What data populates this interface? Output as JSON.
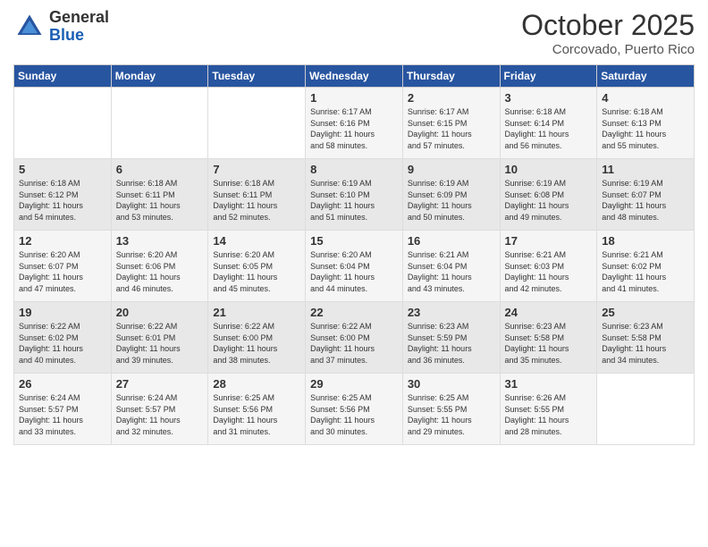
{
  "header": {
    "logo": {
      "text_general": "General",
      "text_blue": "Blue"
    },
    "title": "October 2025",
    "subtitle": "Corcovado, Puerto Rico"
  },
  "days_of_week": [
    "Sunday",
    "Monday",
    "Tuesday",
    "Wednesday",
    "Thursday",
    "Friday",
    "Saturday"
  ],
  "weeks": [
    [
      {
        "day": "",
        "info": ""
      },
      {
        "day": "",
        "info": ""
      },
      {
        "day": "",
        "info": ""
      },
      {
        "day": "1",
        "info": "Sunrise: 6:17 AM\nSunset: 6:16 PM\nDaylight: 11 hours\nand 58 minutes."
      },
      {
        "day": "2",
        "info": "Sunrise: 6:17 AM\nSunset: 6:15 PM\nDaylight: 11 hours\nand 57 minutes."
      },
      {
        "day": "3",
        "info": "Sunrise: 6:18 AM\nSunset: 6:14 PM\nDaylight: 11 hours\nand 56 minutes."
      },
      {
        "day": "4",
        "info": "Sunrise: 6:18 AM\nSunset: 6:13 PM\nDaylight: 11 hours\nand 55 minutes."
      }
    ],
    [
      {
        "day": "5",
        "info": "Sunrise: 6:18 AM\nSunset: 6:12 PM\nDaylight: 11 hours\nand 54 minutes."
      },
      {
        "day": "6",
        "info": "Sunrise: 6:18 AM\nSunset: 6:11 PM\nDaylight: 11 hours\nand 53 minutes."
      },
      {
        "day": "7",
        "info": "Sunrise: 6:18 AM\nSunset: 6:11 PM\nDaylight: 11 hours\nand 52 minutes."
      },
      {
        "day": "8",
        "info": "Sunrise: 6:19 AM\nSunset: 6:10 PM\nDaylight: 11 hours\nand 51 minutes."
      },
      {
        "day": "9",
        "info": "Sunrise: 6:19 AM\nSunset: 6:09 PM\nDaylight: 11 hours\nand 50 minutes."
      },
      {
        "day": "10",
        "info": "Sunrise: 6:19 AM\nSunset: 6:08 PM\nDaylight: 11 hours\nand 49 minutes."
      },
      {
        "day": "11",
        "info": "Sunrise: 6:19 AM\nSunset: 6:07 PM\nDaylight: 11 hours\nand 48 minutes."
      }
    ],
    [
      {
        "day": "12",
        "info": "Sunrise: 6:20 AM\nSunset: 6:07 PM\nDaylight: 11 hours\nand 47 minutes."
      },
      {
        "day": "13",
        "info": "Sunrise: 6:20 AM\nSunset: 6:06 PM\nDaylight: 11 hours\nand 46 minutes."
      },
      {
        "day": "14",
        "info": "Sunrise: 6:20 AM\nSunset: 6:05 PM\nDaylight: 11 hours\nand 45 minutes."
      },
      {
        "day": "15",
        "info": "Sunrise: 6:20 AM\nSunset: 6:04 PM\nDaylight: 11 hours\nand 44 minutes."
      },
      {
        "day": "16",
        "info": "Sunrise: 6:21 AM\nSunset: 6:04 PM\nDaylight: 11 hours\nand 43 minutes."
      },
      {
        "day": "17",
        "info": "Sunrise: 6:21 AM\nSunset: 6:03 PM\nDaylight: 11 hours\nand 42 minutes."
      },
      {
        "day": "18",
        "info": "Sunrise: 6:21 AM\nSunset: 6:02 PM\nDaylight: 11 hours\nand 41 minutes."
      }
    ],
    [
      {
        "day": "19",
        "info": "Sunrise: 6:22 AM\nSunset: 6:02 PM\nDaylight: 11 hours\nand 40 minutes."
      },
      {
        "day": "20",
        "info": "Sunrise: 6:22 AM\nSunset: 6:01 PM\nDaylight: 11 hours\nand 39 minutes."
      },
      {
        "day": "21",
        "info": "Sunrise: 6:22 AM\nSunset: 6:00 PM\nDaylight: 11 hours\nand 38 minutes."
      },
      {
        "day": "22",
        "info": "Sunrise: 6:22 AM\nSunset: 6:00 PM\nDaylight: 11 hours\nand 37 minutes."
      },
      {
        "day": "23",
        "info": "Sunrise: 6:23 AM\nSunset: 5:59 PM\nDaylight: 11 hours\nand 36 minutes."
      },
      {
        "day": "24",
        "info": "Sunrise: 6:23 AM\nSunset: 5:58 PM\nDaylight: 11 hours\nand 35 minutes."
      },
      {
        "day": "25",
        "info": "Sunrise: 6:23 AM\nSunset: 5:58 PM\nDaylight: 11 hours\nand 34 minutes."
      }
    ],
    [
      {
        "day": "26",
        "info": "Sunrise: 6:24 AM\nSunset: 5:57 PM\nDaylight: 11 hours\nand 33 minutes."
      },
      {
        "day": "27",
        "info": "Sunrise: 6:24 AM\nSunset: 5:57 PM\nDaylight: 11 hours\nand 32 minutes."
      },
      {
        "day": "28",
        "info": "Sunrise: 6:25 AM\nSunset: 5:56 PM\nDaylight: 11 hours\nand 31 minutes."
      },
      {
        "day": "29",
        "info": "Sunrise: 6:25 AM\nSunset: 5:56 PM\nDaylight: 11 hours\nand 30 minutes."
      },
      {
        "day": "30",
        "info": "Sunrise: 6:25 AM\nSunset: 5:55 PM\nDaylight: 11 hours\nand 29 minutes."
      },
      {
        "day": "31",
        "info": "Sunrise: 6:26 AM\nSunset: 5:55 PM\nDaylight: 11 hours\nand 28 minutes."
      },
      {
        "day": "",
        "info": ""
      }
    ]
  ]
}
